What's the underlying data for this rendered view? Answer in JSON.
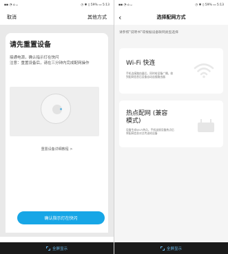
{
  "left": {
    "statusbar": {
      "left": "▪▪ ◔ ⌂ ᴗ",
      "right": "◷ ✱ ▯ 59% ▭ 5:13"
    },
    "header": {
      "cancel": "取消",
      "other": "其他方式"
    },
    "title": "请先重置设备",
    "desc_line1": "接通电源，确认指示灯在快闪",
    "desc_line2": "注意：重置设备后，请在三分钟内完成配网操作",
    "detail_link": "重置设备详细教程 >",
    "confirm_button": "确认指示灯在快闪",
    "fullscreen": "全屏显示"
  },
  "right": {
    "statusbar": {
      "left": "▪▪ ◔ ⌂ ᴗ",
      "right": "◷ ✱ ▯ 59% ▭ 5:13"
    },
    "header": {
      "back": "‹",
      "title": "选择配网方式"
    },
    "hint": "请参照\"说明书\"或根据设备联网类型选择",
    "card1": {
      "title": "Wi-Fi 快连",
      "desc": "手机连接路由器后，同时给设备广播，收到配网信息后设备自动连接路由器"
    },
    "card2": {
      "title_line1": "热点配网 (兼容",
      "title_line2": "模式)",
      "desc": "设备生成Wi-Fi热点，手机连接设备热点后将配网信息对点传送给设备"
    },
    "fullscreen": "全屏显示"
  },
  "colors": {
    "accent": "#17a6e6",
    "fullscreen_text": "#6cb8e8"
  },
  "icons": [
    "wifi-icon",
    "router-icon",
    "fullscreen-icon",
    "back-icon"
  ]
}
